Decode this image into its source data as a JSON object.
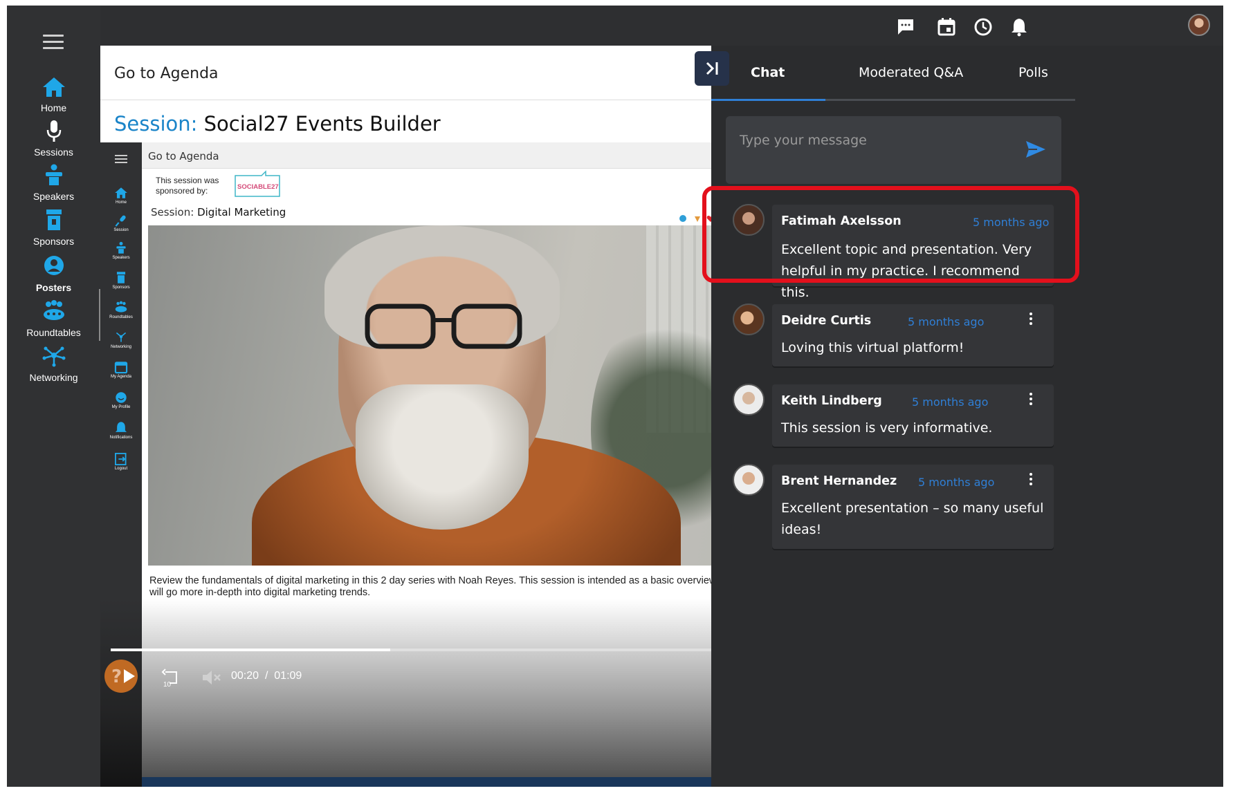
{
  "leftnav": {
    "items": [
      {
        "label": "Home",
        "icon": "home-icon"
      },
      {
        "label": "Sessions",
        "icon": "microphone-icon"
      },
      {
        "label": "Speakers",
        "icon": "speaker-podium-icon"
      },
      {
        "label": "Sponsors",
        "icon": "sponsor-booth-icon"
      },
      {
        "label": "Posters",
        "icon": "user-circle-icon",
        "active": true
      },
      {
        "label": "Roundtables",
        "icon": "roundtable-icon"
      },
      {
        "label": "Networking",
        "icon": "network-icon"
      }
    ]
  },
  "topbar": {
    "icons": [
      "chat-bubble-icon",
      "calendar-icon",
      "clock-icon",
      "bell-icon"
    ]
  },
  "main": {
    "goto_agenda": "Go to Agenda",
    "session_prefix": "Session:",
    "session_name": "Social27 Events Builder"
  },
  "embed": {
    "nav_items": [
      "Home",
      "Session",
      "Speakers",
      "Sponsors",
      "Roundtables",
      "Networking",
      "My Agenda",
      "My Profile",
      "Notifications",
      "Logout"
    ],
    "goto_agenda": "Go to Agenda",
    "sponsored_text": "This session was sponsored by:",
    "sponsor_logo_text": "SOCIABLE27",
    "session_prefix": "Session:",
    "session_name": "Digital Marketing",
    "caption_line1": "Review the fundamentals of digital marketing in this 2 day series with Noah Reyes. This session is intended as a basic overview and Pa",
    "caption_line2": "will go more in-depth into digital marketing trends.",
    "replay_seconds": "10",
    "time_current": "00:20",
    "time_separator": "/",
    "time_total": "01:09",
    "progress_fraction": 0.4
  },
  "chat": {
    "tabs": [
      "Chat",
      "Moderated Q&A",
      "Polls"
    ],
    "input_placeholder": "Type your message",
    "messages": [
      {
        "name": "Fatimah Axelsson",
        "when": "5 months ago",
        "text": "Excellent topic and presentation. Very helpful in my practice. I recommend this.",
        "menu": false
      },
      {
        "name": "Deidre Curtis",
        "when": "5 months ago",
        "text": "Loving this virtual platform!",
        "menu": true
      },
      {
        "name": "Keith Lindberg",
        "when": "5 months ago",
        "text": "This session is very informative.",
        "menu": true
      },
      {
        "name": "Brent Hernandez",
        "when": "5 months ago",
        "text": "Excellent presentation – so many useful ideas!",
        "menu": true
      }
    ]
  },
  "colors": {
    "accent_blue": "#2f7fd6",
    "nav_icon_blue": "#1fa7e8",
    "highlight_red": "#e3101c"
  }
}
